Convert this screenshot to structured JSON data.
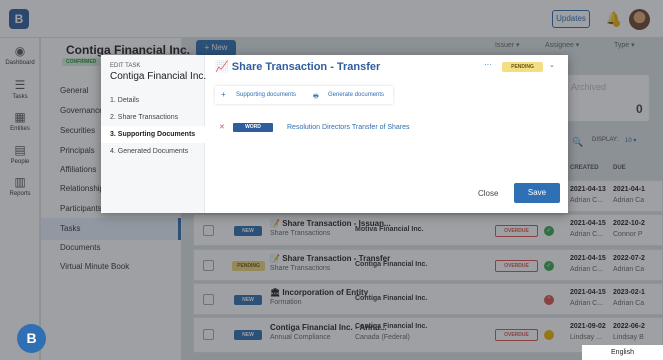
{
  "topbar": {
    "logo": "B",
    "updates": "Updates"
  },
  "leftnav": [
    {
      "label": "Dashboard",
      "icon": "dashboard-icon",
      "glyph": "◉"
    },
    {
      "label": "Tasks",
      "icon": "tasks-icon",
      "glyph": "☰"
    },
    {
      "label": "Entities",
      "icon": "entities-icon",
      "glyph": "▦"
    },
    {
      "label": "People",
      "icon": "people-icon",
      "glyph": "▤"
    },
    {
      "label": "Reports",
      "icon": "reports-icon",
      "glyph": "▥"
    }
  ],
  "company": {
    "name": "Contiga Financial Inc.",
    "status": "CONFIRMED"
  },
  "subnav": [
    "General",
    "Governance",
    "Securities",
    "Principals",
    "Affiliations",
    "Relationships",
    "Participants",
    "Tasks",
    "Documents",
    "Virtual Minute Book"
  ],
  "toolbar": {
    "new": "+ New",
    "issuer": "Issuer",
    "assignee": "Assignee",
    "type": "Type"
  },
  "card": {
    "label": "Archived",
    "count": "0"
  },
  "table": {
    "display_label": "DISPLAY:",
    "display_value": "10",
    "col_created": "CREATED",
    "col_due": "DUE",
    "rows": [
      {
        "badge": "",
        "title": "",
        "sub": "",
        "company": "",
        "company2": "",
        "overdue": "",
        "created": "2021-04-13",
        "due": "2021-04-1",
        "who1": "Adrian C...",
        "who2": "Adrian Ca",
        "dot": "green"
      },
      {
        "badge": "NEW",
        "title": "Share Transaction - Issuan...",
        "sub": "Share Transactions",
        "company": "Motiva Financial Inc.",
        "company2": "",
        "overdue": "OVERDUE",
        "created": "2021-04-15",
        "due": "2022-10-2",
        "who1": "Adrian C...",
        "who2": "Connor P",
        "dot": "green"
      },
      {
        "badge": "PENDING",
        "title": "Share Transaction - Transfer",
        "sub": "Share Transactions",
        "company": "Contiga Financial Inc.",
        "company2": "",
        "overdue": "OVERDUE",
        "created": "2021-04-15",
        "due": "2022-07-2",
        "who1": "Adrian C...",
        "who2": "Adrian Ca",
        "dot": "green"
      },
      {
        "badge": "NEW",
        "title": "Incorporation of Entity",
        "sub": "Formation",
        "company": "Contiga Financial Inc.",
        "company2": "",
        "overdue": "",
        "created": "2021-04-15",
        "due": "2023-02-1",
        "who1": "Adrian C...",
        "who2": "Adrian Ca",
        "dot": "red"
      },
      {
        "badge": "NEW",
        "title": "Contiga Financial Inc. - Annu...",
        "sub": "Annual Compliance",
        "company": "Contiga Financial Inc.",
        "company2": "Canada (Federal)",
        "overdue": "OVERDUE",
        "created": "2021-09-02",
        "due": "2022-06-2",
        "who1": "Lindsay ...",
        "who2": "Lindsay B",
        "dot": "yellow"
      }
    ]
  },
  "modal": {
    "edit_task": "EDIT TASK",
    "company": "Contiga Financial Inc.",
    "steps": [
      "1. Details",
      "2. Share Transactions",
      "3. Supporting Documents",
      "4. Generated Documents"
    ],
    "active_step": 2,
    "title": "Share Transaction - Transfer",
    "more": "···",
    "status": "PENDING",
    "tab_supporting": "Supporting documents",
    "tab_generate": "Generate documents",
    "doc_type": "WORD",
    "doc_name": "Resolution Directors Transfer of Shares",
    "close": "Close",
    "save": "Save"
  },
  "footer": {
    "language": "English"
  },
  "colors": {
    "primary": "#2f6fb3",
    "overdue": "#d9534f",
    "pending": "#f3de84"
  }
}
